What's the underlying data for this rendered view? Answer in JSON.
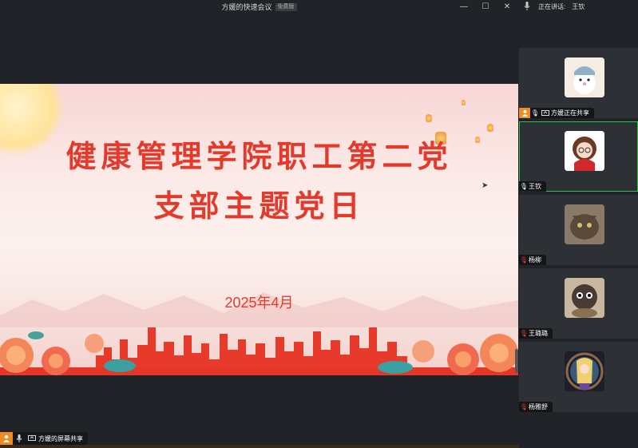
{
  "window": {
    "title": "方媛的快速会议",
    "badge": "免费版"
  },
  "slide": {
    "title_line1": "健康管理学院职工第二党",
    "title_line2": "支部主题党日",
    "date": "2025年4月"
  },
  "share_bar": {
    "label": "方媛的屏幕共享"
  },
  "sidebar": {
    "speaking_label": "正在讲话:",
    "speaking_name": "王钦",
    "participants": [
      {
        "name": "方媛正在共享",
        "role": "sharer"
      },
      {
        "name": "王钦",
        "role": "active"
      },
      {
        "name": "杨柳",
        "role": "muted"
      },
      {
        "name": "王璐璐",
        "role": "muted"
      },
      {
        "name": "杨雅舒",
        "role": "muted"
      }
    ]
  },
  "colors": {
    "accent_green": "#2fbf4f",
    "accent_orange": "#f08a24",
    "title_red": "#e43a2c",
    "muted_red": "#e0413a"
  }
}
